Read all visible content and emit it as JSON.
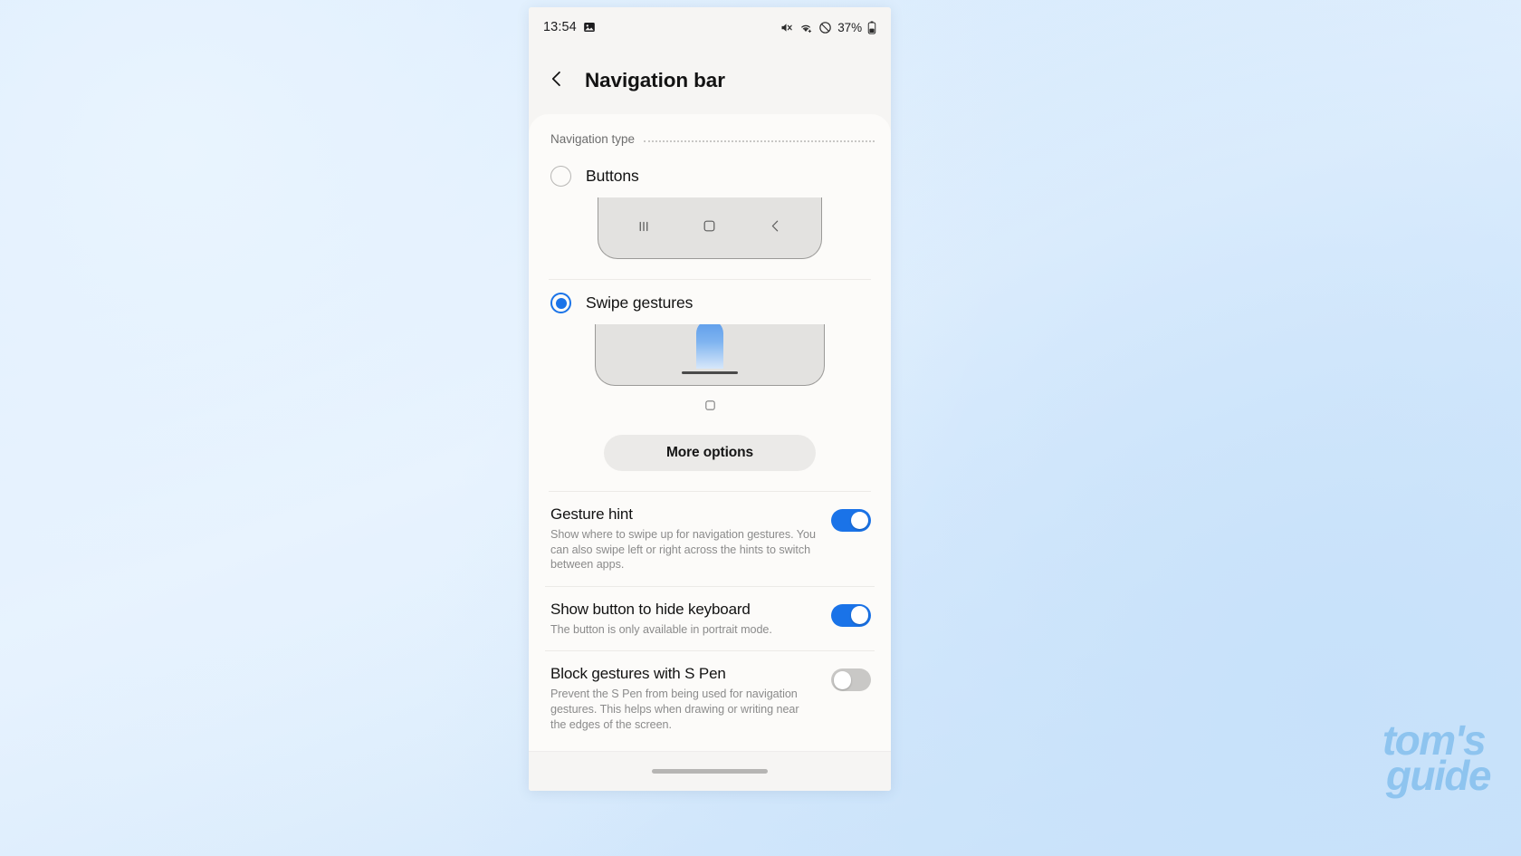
{
  "status_bar": {
    "time": "13:54",
    "gallery_icon": "image-icon",
    "mute_icon": "mute-icon",
    "wifi_icon": "wifi-plus-icon",
    "dnd_icon": "do-not-disturb-icon",
    "battery_percent": "37%",
    "battery_icon": "battery-icon"
  },
  "header": {
    "back_icon": "chevron-left-icon",
    "title": "Navigation bar"
  },
  "navigation_type": {
    "section_label": "Navigation type",
    "options": [
      {
        "label": "Buttons",
        "selected": false
      },
      {
        "label": "Swipe gestures",
        "selected": true
      }
    ],
    "buttons_preview": {
      "recents_icon": "recents-icon",
      "home_icon": "home-square-icon",
      "back_icon": "back-chevron-icon"
    },
    "gesture_preview": {
      "swipe_arrow_icon": "swipe-up-arrow-icon",
      "handle_icon": "gesture-handle-icon",
      "home_square_icon": "home-square-icon"
    },
    "more_options_label": "More options"
  },
  "settings": [
    {
      "title": "Gesture hint",
      "description": "Show where to swipe up for navigation gestures. You can also swipe left or right across the hints to switch between apps.",
      "enabled": true
    },
    {
      "title": "Show button to hide keyboard",
      "description": "The button is only available in portrait mode.",
      "enabled": true
    },
    {
      "title": "Block gestures with S Pen",
      "description": "Prevent the S Pen from being used for navigation gestures. This helps when drawing or writing near the edges of the screen.",
      "enabled": false
    }
  ],
  "bottom_bar": {
    "home_indicator": "home-indicator"
  },
  "watermark": {
    "line1": "tom's",
    "line2": "guide",
    "color": "#8ec4ef"
  },
  "colors": {
    "accent": "#1a73e8",
    "phone_bg": "#f6f5f3",
    "card_bg": "#fcfbf9",
    "title_text": "#131313",
    "desc_text": "#8b8b8b"
  }
}
